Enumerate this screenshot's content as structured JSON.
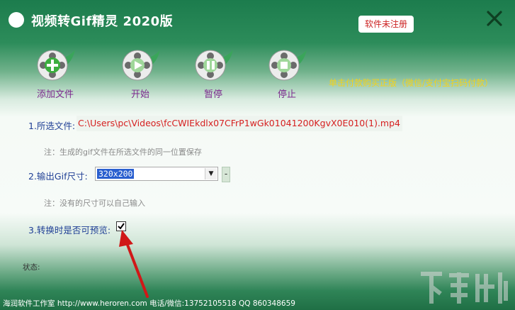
{
  "window": {
    "title": "视频转Gif精灵 2020版",
    "register_button": "软件未注册",
    "close_icon": "close-x-icon"
  },
  "toolbar": [
    {
      "label": "添加文件",
      "icon": "add-film-reel-icon"
    },
    {
      "label": "开始",
      "icon": "play-film-reel-icon"
    },
    {
      "label": "暂停",
      "icon": "pause-film-reel-icon"
    },
    {
      "label": "停止",
      "icon": "stop-film-reel-icon"
    }
  ],
  "pay_link": "单击付款购买正版（微信/支付宝扫码付款）",
  "form": {
    "file_label": "1.所选文件:",
    "file_path": "C:\\Users\\pc\\Videos\\fcCWIEkdlx07CFrP1wGk01041200KgvX0E010(1).mp4",
    "file_note": "注：生成的gif文件在所选文件的同一位置保存",
    "size_label": "2.输出Gif尺寸:",
    "size_value": "320x200",
    "size_button": "-",
    "size_note": "注：没有的尺寸可以自己输入",
    "preview_label": "3.转换时是否可预览:",
    "preview_checked": true
  },
  "status_label": "状态:",
  "footer": "海润软件工作室 http://www.heroren.com  电话/微信:13752105518  QQ 860348659",
  "colors": {
    "title_bar": "#1c7c4d",
    "label_blue": "#1f3f95",
    "path_red": "#d62020",
    "toolbar_purple": "#7d2a8f",
    "pay_yellow": "#f2d21c"
  }
}
